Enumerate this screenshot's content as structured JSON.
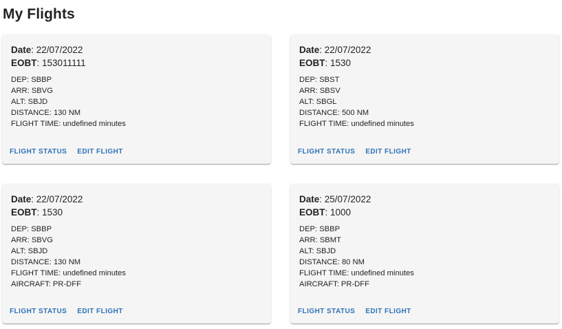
{
  "page": {
    "title": "My Flights"
  },
  "labels": {
    "date": "Date",
    "eobt": "EOBT",
    "flight_status": "FLIGHT STATUS",
    "edit_flight": "EDIT FLIGHT"
  },
  "flights": [
    {
      "date": "22/07/2022",
      "eobt": "153011111",
      "details": [
        "DEP: SBBP",
        "ARR: SBVG",
        "ALT: SBJD",
        "DISTANCE: 130 NM",
        "FLIGHT TIME: undefined minutes"
      ]
    },
    {
      "date": "22/07/2022",
      "eobt": "1530",
      "details": [
        "DEP: SBST",
        "ARR: SBSV",
        "ALT: SBGL",
        "DISTANCE: 500 NM",
        "FLIGHT TIME: undefined minutes"
      ]
    },
    {
      "date": "22/07/2022",
      "eobt": "1530",
      "details": [
        "DEP: SBBP",
        "ARR: SBVG",
        "ALT: SBJD",
        "DISTANCE: 130 NM",
        "FLIGHT TIME: undefined minutes",
        "AIRCRAFT: PR-DFF"
      ]
    },
    {
      "date": "25/07/2022",
      "eobt": "1000",
      "details": [
        "DEP: SBBP",
        "ARR: SBMT",
        "ALT: SBJD",
        "DISTANCE: 80 NM",
        "FLIGHT TIME: undefined minutes",
        "AIRCRAFT: PR-DFF"
      ]
    }
  ],
  "colors": {
    "card_bg": "#f5f5f5",
    "action": "#2f73b5"
  }
}
